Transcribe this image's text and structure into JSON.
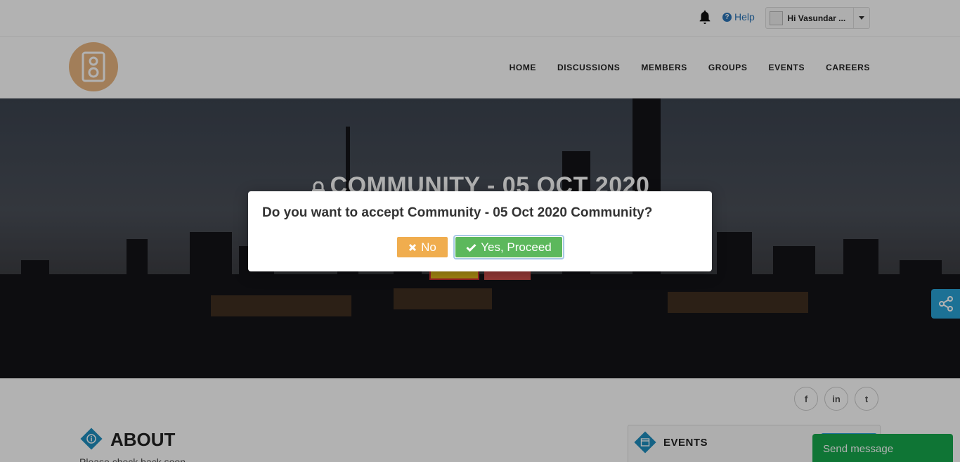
{
  "topbar": {
    "help_label": "Help",
    "user_label": "Hi Vasundar ..."
  },
  "nav": {
    "items": [
      "HOME",
      "DISCUSSIONS",
      "MEMBERS",
      "GROUPS",
      "EVENTS",
      "CAREERS"
    ]
  },
  "hero": {
    "title": "COMMUNITY - 05 OCT 2020"
  },
  "social": {
    "facebook": "f",
    "linkedin": "in",
    "twitter": "t"
  },
  "about": {
    "title": "ABOUT",
    "text": "Please check back soon..."
  },
  "events": {
    "title": "EVENTS"
  },
  "chat": {
    "send_message_label": "Send message"
  },
  "modal": {
    "question": "Do you want to accept Community - 05 Oct 2020 Community?",
    "no_label": "No",
    "yes_label": "Yes, Proceed"
  },
  "colors": {
    "accent_blue": "#29a3d6",
    "no_button": "#f0ad4e",
    "yes_button": "#5cb85c",
    "send_message": "#16a84d",
    "logo": "#e8b580"
  }
}
